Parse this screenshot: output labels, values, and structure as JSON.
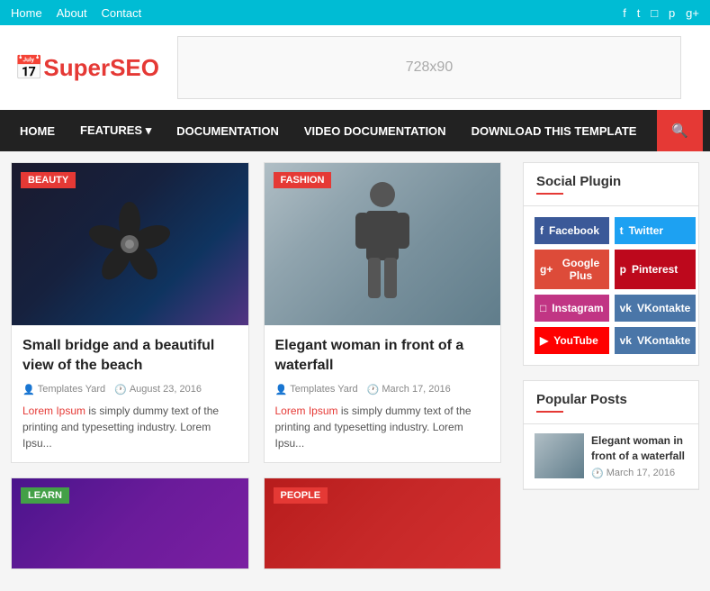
{
  "topBar": {
    "navLinks": [
      "Home",
      "About",
      "Contact"
    ],
    "socialIcons": [
      "facebook",
      "twitter",
      "instagram",
      "pinterest",
      "googleplus"
    ]
  },
  "header": {
    "logoText": "Super",
    "logoSEO": "SEO",
    "adBannerText": "728x90"
  },
  "nav": {
    "items": [
      {
        "label": "HOME",
        "active": true
      },
      {
        "label": "FEATURES",
        "hasDropdown": true
      },
      {
        "label": "DOCUMENTATION"
      },
      {
        "label": "VIDEO DOCUMENTATION"
      },
      {
        "label": "DOWNLOAD THIS TEMPLATE"
      }
    ],
    "searchLabel": "🔍"
  },
  "posts": [
    {
      "id": "post-1",
      "badge": "BEAUTY",
      "badgeClass": "badge-beauty",
      "title": "Small bridge and a beautiful view of the beach",
      "author": "Templates Yard",
      "date": "August 23, 2016",
      "excerpt": "Lorem Ipsum is simply dummy text of the printing and typesetting industry. Lorem Ipsu..."
    },
    {
      "id": "post-2",
      "badge": "FASHION",
      "badgeClass": "badge-fashion",
      "title": "Elegant woman in front of a waterfall",
      "author": "Templates Yard",
      "date": "March 17, 2016",
      "excerpt": "Lorem Ipsum is simply dummy text of the printing and typesetting industry. Lorem Ipsu..."
    },
    {
      "id": "post-3",
      "badge": "LEARN",
      "badgeClass": "badge-learn",
      "title": "",
      "author": "",
      "date": "",
      "excerpt": ""
    },
    {
      "id": "post-4",
      "badge": "PEOPLE",
      "badgeClass": "badge-people",
      "title": "",
      "author": "",
      "date": "",
      "excerpt": ""
    }
  ],
  "sidebar": {
    "socialPlugin": {
      "title": "Social Plugin",
      "buttons": [
        {
          "label": "Facebook",
          "class": "btn-facebook",
          "icon": "f"
        },
        {
          "label": "Twitter",
          "class": "btn-twitter",
          "icon": "t"
        },
        {
          "label": "Google Plus",
          "class": "btn-googleplus",
          "icon": "g+"
        },
        {
          "label": "Pinterest",
          "class": "btn-pinterest",
          "icon": "p"
        },
        {
          "label": "Instagram",
          "class": "btn-instagram",
          "icon": "in"
        },
        {
          "label": "VKontakte",
          "class": "btn-vkontakte",
          "icon": "vk"
        },
        {
          "label": "YouTube",
          "class": "btn-youtube",
          "icon": "▶"
        },
        {
          "label": "VKontakte",
          "class": "btn-vkontakte",
          "icon": "vk"
        }
      ]
    },
    "popularPosts": {
      "title": "Popular Posts",
      "items": [
        {
          "title": "Elegant woman in front of a waterfall",
          "date": "March 17, 2016"
        }
      ]
    }
  },
  "lorem": "Lorem Ipsum is simply dummy text of the printing and typesetting industry. Lorem Ipsu..."
}
